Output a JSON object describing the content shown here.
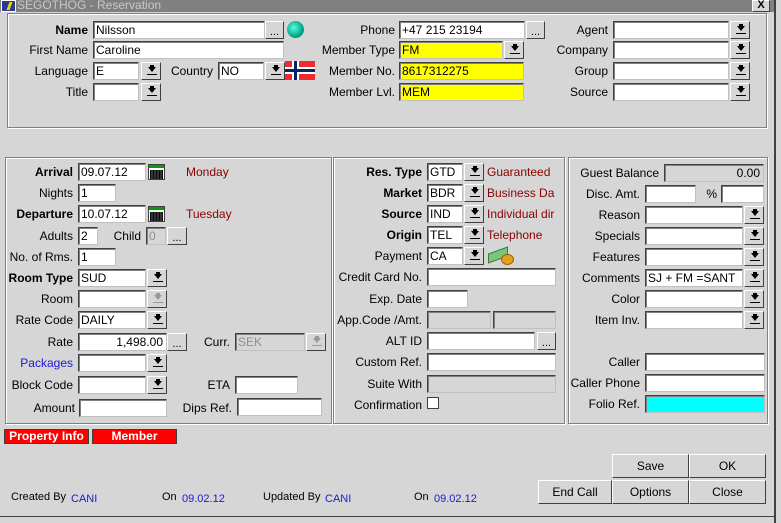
{
  "window": {
    "title": "SEGOTHOG - Reservation",
    "close_label": "X"
  },
  "guest": {
    "name_label": "Name",
    "name_value": "Nilsson",
    "first_name_label": "First Name",
    "first_name_value": "Caroline",
    "language_label": "Language",
    "language_value": "E",
    "country_label": "Country",
    "country_value": "NO",
    "title_label": "Title",
    "title_value": "",
    "phone_label": "Phone",
    "phone_value": "+47 215 23194",
    "member_type_label": "Member Type",
    "member_type_value": "FM",
    "member_no_label": "Member No.",
    "member_no_value": "8617312275",
    "member_lvl_label": "Member Lvl.",
    "member_lvl_value": "MEM",
    "agent_label": "Agent",
    "agent_value": "",
    "company_label": "Company",
    "company_value": "",
    "group_label": "Group",
    "group_value": "",
    "source_label": "Source",
    "source_value": "",
    "ellipsis": "..."
  },
  "stay": {
    "arrival_label": "Arrival",
    "arrival_value": "09.07.12",
    "arrival_day": "Monday",
    "nights_label": "Nights",
    "nights_value": "1",
    "departure_label": "Departure",
    "departure_value": "10.07.12",
    "departure_day": "Tuesday",
    "adults_label": "Adults",
    "adults_value": "2",
    "child_label": "Child",
    "child_value": "0",
    "rooms_label": "No. of Rms.",
    "rooms_value": "1",
    "room_type_label": "Room Type",
    "room_type_value": "SUD",
    "room_label": "Room",
    "room_value": "",
    "rate_code_label": "Rate Code",
    "rate_code_value": "DAILY",
    "rate_label": "Rate",
    "rate_value": "1,498.00",
    "curr_label": "Curr.",
    "curr_value": "SEK",
    "packages_label": "Packages",
    "packages_value": "",
    "block_code_label": "Block Code",
    "block_code_value": "",
    "eta_label": "ETA",
    "eta_value": "",
    "amount_label": "Amount",
    "amount_value": "",
    "dips_ref_label": "Dips Ref.",
    "dips_ref_value": ""
  },
  "booking": {
    "res_type_label": "Res. Type",
    "res_type_value": "GTD",
    "res_type_desc": "Guaranteed",
    "market_label": "Market",
    "market_value": "BDR",
    "market_desc": "Business Da",
    "source_label": "Source",
    "source_value": "IND",
    "source_desc": "Individual dir",
    "origin_label": "Origin",
    "origin_value": "TEL",
    "origin_desc": "Telephone",
    "payment_label": "Payment",
    "payment_value": "CA",
    "cc_label": "Credit Card No.",
    "cc_value": "",
    "exp_label": "Exp. Date",
    "exp_value": "",
    "appcode_label": "App.Code /Amt.",
    "altid_label": "ALT ID",
    "altid_value": "",
    "custom_ref_label": "Custom Ref.",
    "custom_ref_value": "",
    "suite_with_label": "Suite With",
    "suite_with_value": "",
    "confirmation_label": "Confirmation",
    "confirmation_checked": false
  },
  "extras": {
    "guest_balance_label": "Guest Balance",
    "guest_balance_value": "0.00",
    "disc_amt_label": "Disc. Amt.",
    "disc_amt_value": "",
    "percent_label": "%",
    "percent_value": "",
    "reason_label": "Reason",
    "reason_value": "",
    "specials_label": "Specials",
    "specials_value": "",
    "features_label": "Features",
    "features_value": "",
    "comments_label": "Comments",
    "comments_value": "SJ + FM =SANT",
    "color_label": "Color",
    "color_value": "",
    "item_inv_label": "Item Inv.",
    "item_inv_value": "",
    "caller_label": "Caller",
    "caller_value": "",
    "caller_phone_label": "Caller Phone",
    "caller_phone_value": "",
    "folio_ref_label": "Folio Ref.",
    "folio_ref_value": ""
  },
  "flags": {
    "property_info": "Property Info",
    "member": "Member"
  },
  "footer": {
    "created_by_label": "Created By",
    "created_by": "CANI",
    "created_on_label": "On",
    "created_on": "09.02.12",
    "updated_by_label": "Updated By",
    "updated_by": "CANI",
    "updated_on_label": "On",
    "updated_on": "09.02.12"
  },
  "buttons": {
    "save": "Save",
    "ok": "OK",
    "end_call": "End Call",
    "options": "Options",
    "close": "Close"
  },
  "colors": {
    "mandatory_highlight": "#ffff00",
    "folio_highlight": "#00ffff",
    "flag_button": "#ff0000",
    "description_text": "#8b0000",
    "link_text": "#1a1acc"
  }
}
